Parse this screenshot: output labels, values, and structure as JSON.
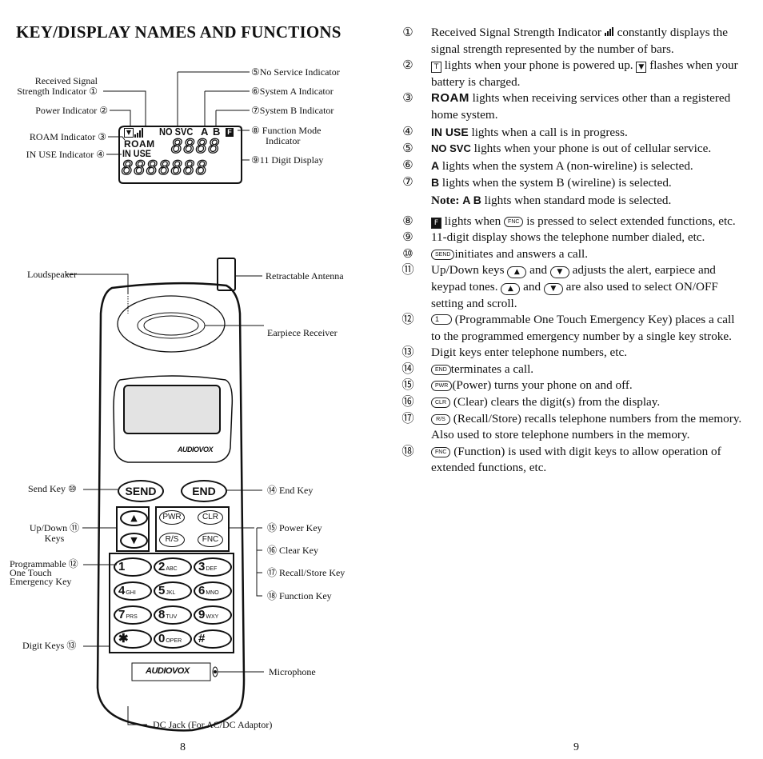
{
  "title": "KEY/DISPLAY NAMES AND FUNCTIONS",
  "lcd_diagram": {
    "labels_left": [
      {
        "num": "①",
        "text_line1": "Received Signal",
        "text_line2": "Strength Indicator"
      },
      {
        "num": "②",
        "text": "Power Indicator"
      },
      {
        "num": "③",
        "text": "ROAM Indicator"
      },
      {
        "num": "④",
        "text": "IN USE Indicator"
      }
    ],
    "labels_right": [
      {
        "num": "⑤",
        "text": "No Service Indicator"
      },
      {
        "num": "⑥",
        "text": "System A Indicator"
      },
      {
        "num": "⑦",
        "text": "System B Indicator"
      },
      {
        "num": "⑧",
        "text_line1": "Function Mode",
        "text_line2": "Indicator"
      },
      {
        "num": "⑨",
        "text": "11 Digit Display"
      }
    ],
    "display": {
      "power_icon": "▼",
      "no_svc": "NO SVC",
      "sys_a": "A",
      "sys_b": "B",
      "func_icon": "F",
      "roam": "ROAM",
      "in_use": "IN USE",
      "top_digits": "8888",
      "bottom_digits": "8888888"
    }
  },
  "phone_diagram": {
    "labels": {
      "loudspeaker": "Loudspeaker",
      "antenna": "Retractable Antenna",
      "earpiece": "Earpiece Receiver",
      "send_key": "Send Key ⑩",
      "end_key": "⑭ End Key",
      "updown_line1": "Up/Down ⑪",
      "updown_line2": "Keys",
      "prog_line1": "Programmable ⑫",
      "prog_line2": "One Touch",
      "prog_line3": "Emergency Key",
      "power_key": "⑮ Power Key",
      "clear_key": "⑯ Clear Key",
      "recall_key": "⑰ Recall/Store Key",
      "function_key": "⑱ Function Key",
      "digit_keys": "Digit Keys ⑬",
      "microphone": "Microphone",
      "dc_jack": "DC Jack (For AC/DC Adaptor)"
    },
    "brand_top": "AUDIOVOX",
    "brand_bottom": "AUDIOVOX",
    "keys": {
      "send": "SEND",
      "end": "END",
      "up": "▲",
      "down": "▼",
      "pwr": "PWR",
      "clr": "CLR",
      "rs": "R/S",
      "fnc": "FNC",
      "digits": [
        {
          "num": "1",
          "letters": ""
        },
        {
          "num": "2",
          "letters": "ABC"
        },
        {
          "num": "3",
          "letters": "DEF"
        },
        {
          "num": "4",
          "letters": "GHI"
        },
        {
          "num": "5",
          "letters": "JKL"
        },
        {
          "num": "6",
          "letters": "MNO"
        },
        {
          "num": "7",
          "letters": "PRS"
        },
        {
          "num": "8",
          "letters": "TUV"
        },
        {
          "num": "9",
          "letters": "WXY"
        },
        {
          "num": "✱",
          "letters": ""
        },
        {
          "num": "0",
          "letters": "OPER"
        },
        {
          "num": "#",
          "letters": ""
        }
      ]
    }
  },
  "descriptions": {
    "d1": {
      "num": "①",
      "pre": "Received Signal Strength Indicator",
      "post": "constantly displays the signal strength represented by the number of bars."
    },
    "d2": {
      "num": "②",
      "a": "lights when your phone is powered up.",
      "b": "flashes when your battery is charged."
    },
    "d3": {
      "num": "③",
      "kw": "ROAM",
      "text": "lights when receiving services other than a registered home system."
    },
    "d4": {
      "num": "④",
      "kw": "IN USE",
      "text": "lights when a call is in progress."
    },
    "d5": {
      "num": "⑤",
      "kw": "NO SVC",
      "text": "lights when your phone is out of cellular service."
    },
    "d6": {
      "num": "⑥",
      "kw": "A",
      "text": "lights when the system A (non-wireline) is selected."
    },
    "d7": {
      "num": "⑦",
      "kw": "B",
      "text": "lights when the system B (wireline) is selected."
    },
    "note": {
      "label": "Note:",
      "kw": "A B",
      "text": "lights when standard mode is selected."
    },
    "d8": {
      "num": "⑧",
      "a": "lights when",
      "key": "FNC",
      "b": "is pressed to select extended functions, etc."
    },
    "d9": {
      "num": "⑨",
      "text": "11-digit display shows the telephone number dialed, etc."
    },
    "d10": {
      "num": "⑩",
      "key": "SEND",
      "text": "initiates and answers a call."
    },
    "d11": {
      "num": "⑪",
      "a": "Up/Down keys",
      "and1": "and",
      "b": "adjusts the alert, earpiece and keypad tones.",
      "and2": "and",
      "c": "are also used to select ON/OFF setting and scroll."
    },
    "d12": {
      "num": "⑫",
      "key": "1",
      "text": "(Programmable One Touch Emergency Key) places a call to the programmed emergency number by a single key stroke."
    },
    "d13": {
      "num": "⑬",
      "text": "Digit keys enter telephone numbers, etc."
    },
    "d14": {
      "num": "⑭",
      "key": "END",
      "text": "terminates a call."
    },
    "d15": {
      "num": "⑮",
      "key": "PWR",
      "text": "(Power) turns your phone on and off."
    },
    "d16": {
      "num": "⑯",
      "key": "CLR",
      "text": "(Clear) clears the digit(s) from the display."
    },
    "d17": {
      "num": "⑰",
      "key": "R/S",
      "text": "(Recall/Store) recalls telephone numbers from the memory. Also used to store telephone numbers in the memory."
    },
    "d18": {
      "num": "⑱",
      "key": "FNC",
      "text": "(Function) is used with digit keys to allow operation of extended functions, etc."
    }
  },
  "page_numbers": {
    "left": "8",
    "right": "9"
  }
}
